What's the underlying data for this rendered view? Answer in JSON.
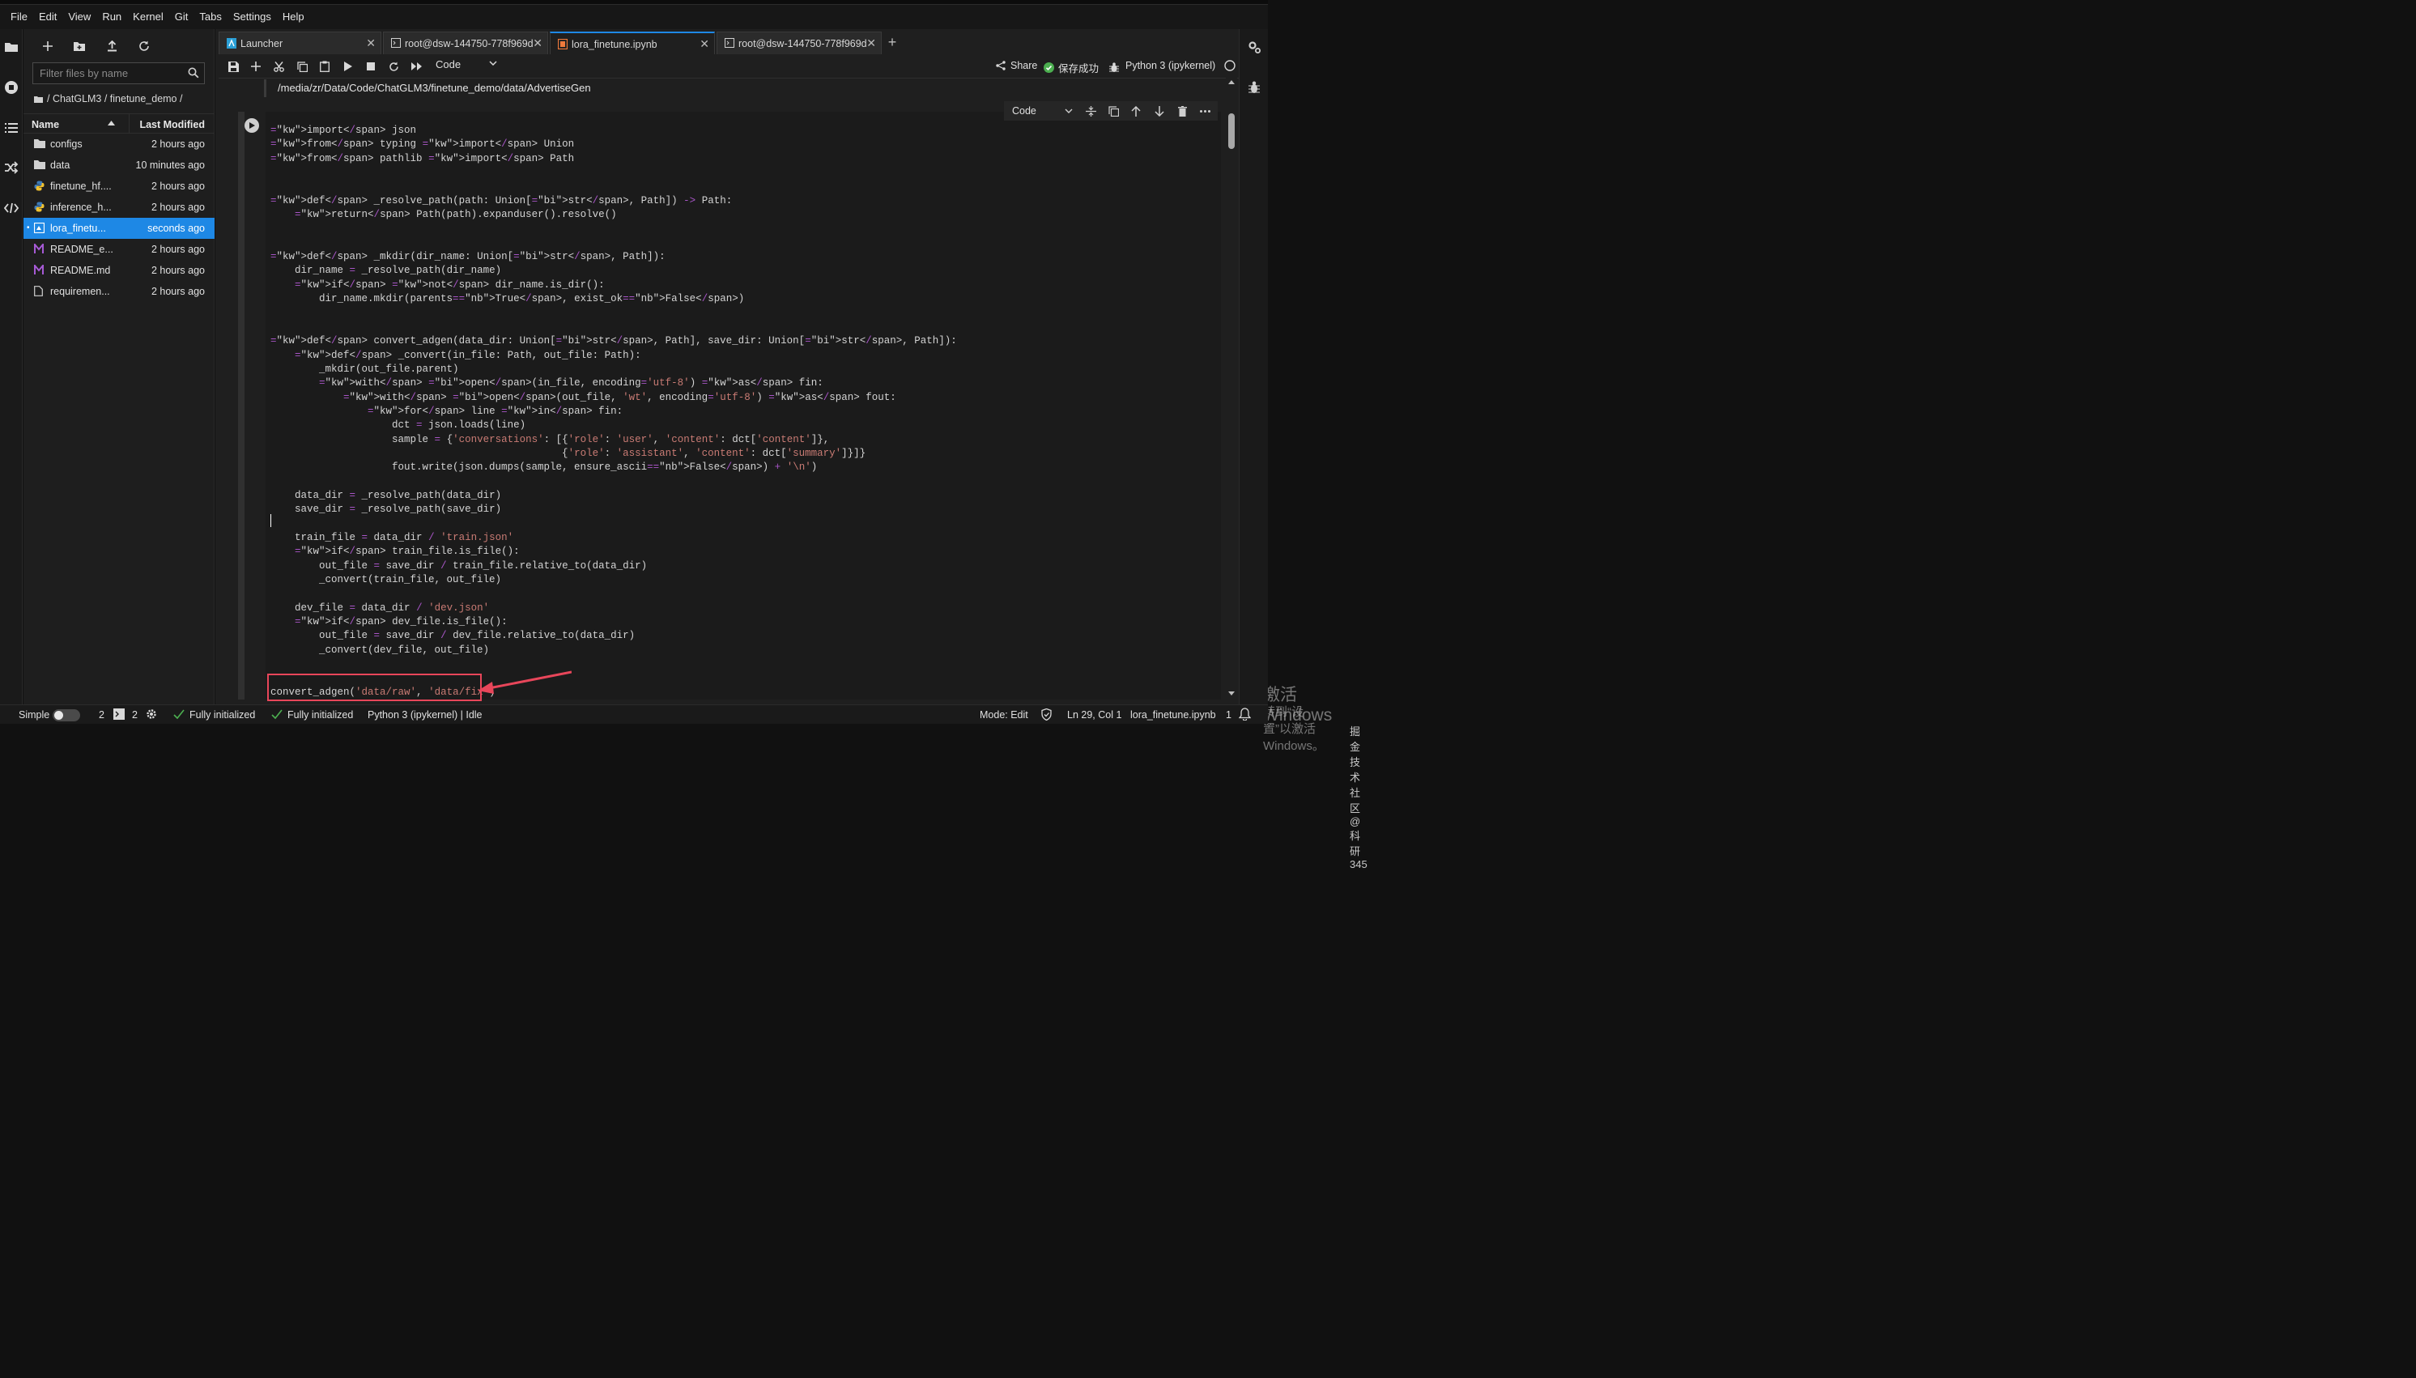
{
  "menubar": [
    "File",
    "Edit",
    "View",
    "Run",
    "Kernel",
    "Git",
    "Tabs",
    "Settings",
    "Help"
  ],
  "filebrowser": {
    "filter_placeholder": "Filter files by name",
    "breadcrumb": "/ ChatGLM3 / finetune_demo /",
    "col_name": "Name",
    "col_modified": "Last Modified",
    "files": [
      {
        "name": "configs",
        "modified": "2 hours ago",
        "icon": "folder-icon"
      },
      {
        "name": "data",
        "modified": "10 minutes ago",
        "icon": "folder-icon"
      },
      {
        "name": "finetune_hf....",
        "modified": "2 hours ago",
        "icon": "python-file-icon"
      },
      {
        "name": "inference_h...",
        "modified": "2 hours ago",
        "icon": "python-file-icon"
      },
      {
        "name": "lora_finetu...",
        "modified": "seconds ago",
        "icon": "notebook-icon",
        "selected": true,
        "running_dot": "•"
      },
      {
        "name": "README_e...",
        "modified": "2 hours ago",
        "icon": "markdown-icon"
      },
      {
        "name": "README.md",
        "modified": "2 hours ago",
        "icon": "markdown-icon"
      },
      {
        "name": "requiremen...",
        "modified": "2 hours ago",
        "icon": "file-icon"
      }
    ]
  },
  "tabs": [
    {
      "label": "Launcher",
      "icon": "launcher-icon",
      "active": false
    },
    {
      "label": "root@dsw-144750-778f969d",
      "icon": "terminal-icon",
      "active": false
    },
    {
      "label": "lora_finetune.ipynb",
      "icon": "notebook-icon",
      "active": true
    },
    {
      "label": "root@dsw-144750-778f969d",
      "icon": "terminal-icon",
      "active": false
    }
  ],
  "toolbar": {
    "cell_type": "Code",
    "share_label": "Share",
    "saved_label": "保存成功",
    "kernel_label": "Python 3 (ipykernel)"
  },
  "path_output": "/media/zr/Data/Code/ChatGLM3/finetune_demo/data/AdvertiseGen",
  "cell_toolbar": {
    "type_label": "Code"
  },
  "code_lines": [
    "import json",
    "from typing import Union",
    "from pathlib import Path",
    "",
    "",
    "def _resolve_path(path: Union[str, Path]) -> Path:",
    "    return Path(path).expanduser().resolve()",
    "",
    "",
    "def _mkdir(dir_name: Union[str, Path]):",
    "    dir_name = _resolve_path(dir_name)",
    "    if not dir_name.is_dir():",
    "        dir_name.mkdir(parents=True, exist_ok=False)",
    "",
    "",
    "def convert_adgen(data_dir: Union[str, Path], save_dir: Union[str, Path]):",
    "    def _convert(in_file: Path, out_file: Path):",
    "        _mkdir(out_file.parent)",
    "        with open(in_file, encoding='utf-8') as fin:",
    "            with open(out_file, 'wt', encoding='utf-8') as fout:",
    "                for line in fin:",
    "                    dct = json.loads(line)",
    "                    sample = {'conversations': [{'role': 'user', 'content': dct['content']},",
    "                                                {'role': 'assistant', 'content': dct['summary']}]}",
    "                    fout.write(json.dumps(sample, ensure_ascii=False) + '\\n')",
    "",
    "    data_dir = _resolve_path(data_dir)",
    "    save_dir = _resolve_path(save_dir)",
    "",
    "    train_file = data_dir / 'train.json'",
    "    if train_file.is_file():",
    "        out_file = save_dir / train_file.relative_to(data_dir)",
    "        _convert(train_file, out_file)",
    "",
    "    dev_file = data_dir / 'dev.json'",
    "    if dev_file.is_file():",
    "        out_file = save_dir / dev_file.relative_to(data_dir)",
    "        _convert(dev_file, out_file)",
    "",
    "",
    "convert_adgen('data/raw', 'data/fix')"
  ],
  "watermark": {
    "line1": "激活 Windows",
    "line2": "转到“设置”以激活 Windows。",
    "line3": "掘金技术社区 @ 科研345"
  },
  "statusbar": {
    "mode_simple": "Simple",
    "terminals_count": "2",
    "kernels_count": "2",
    "lsp_status_1": "Fully initialized",
    "lsp_status_2": "Fully initialized",
    "kernel_status": "Python 3 (ipykernel) | Idle",
    "edit_mode": "Mode: Edit",
    "cursor_pos": "Ln 29, Col 1",
    "file_name": "lora_finetune.ipynb",
    "notifications": "1"
  },
  "colors": {
    "accent": "#1e88e5",
    "keyword": "#55a9e8",
    "string": "#c97b74",
    "annotation_red": "#e8465a",
    "saved_green": "#4caf50"
  }
}
